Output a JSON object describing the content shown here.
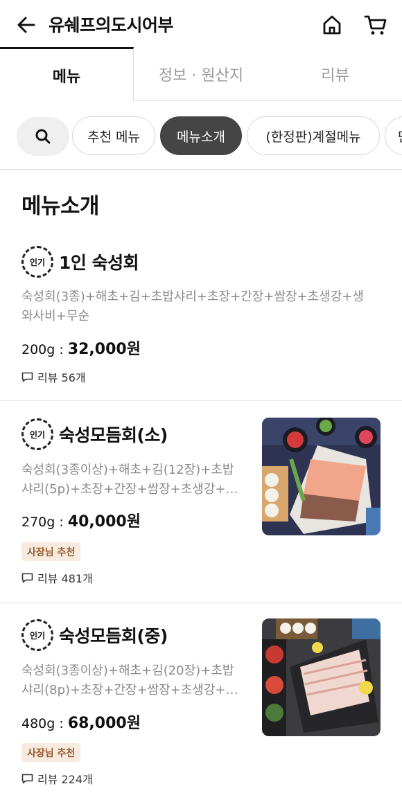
{
  "header": {
    "title": "유쉐프의도시어부",
    "back_icon": "arrow-left-icon",
    "home_icon": "home-icon",
    "cart_icon": "cart-icon"
  },
  "tabs": [
    {
      "label": "메뉴",
      "active": true
    },
    {
      "label": "정보 · 원산지",
      "active": false
    },
    {
      "label": "리뷰",
      "active": false
    }
  ],
  "chips": {
    "search_icon": "search-icon",
    "items": [
      {
        "label": "추천 메뉴",
        "active": false
      },
      {
        "label": "메뉴소개",
        "active": true
      },
      {
        "label": "(한정판)계절메뉴",
        "active": false
      },
      {
        "label": "단",
        "active": false
      }
    ]
  },
  "section": {
    "title": "메뉴소개"
  },
  "menu_items": [
    {
      "badge": "인기",
      "name": "1인 숙성회",
      "desc_line1": "숙성회(3종)+해초+김+초밥샤리+초장+간장+쌈장+초생강+생",
      "desc_line2": "와사비+무순",
      "weight": "200g : ",
      "price": "32,000원",
      "owner_badge": "",
      "reviews": "리뷰 56개",
      "has_image": false
    },
    {
      "badge": "인기",
      "name": "숙성모듬회(소)",
      "desc_line1": "숙성회(3종이상)+해초+김(12장)+초밥",
      "desc_line2": "샤리(5p)+초장+간장+쌈장+초생강+…",
      "weight": "270g : ",
      "price": "40,000원",
      "owner_badge": "사장님 추천",
      "reviews": "리뷰 481개",
      "has_image": true
    },
    {
      "badge": "인기",
      "name": "숙성모듬회(중)",
      "desc_line1": "숙성회(3종이상)+해초+김(20장)+초밥",
      "desc_line2": "샤리(8p)+초장+간장+쌈장+초생강+…",
      "weight": "480g : ",
      "price": "68,000원",
      "owner_badge": "사장님 추천",
      "reviews": "리뷰 224개",
      "has_image": true
    }
  ],
  "colors": {
    "active_chip_bg": "#454545",
    "owner_badge_bg": "#f7ebdf",
    "owner_badge_text": "#9a5a2c",
    "muted_text": "#8a8a8a"
  }
}
